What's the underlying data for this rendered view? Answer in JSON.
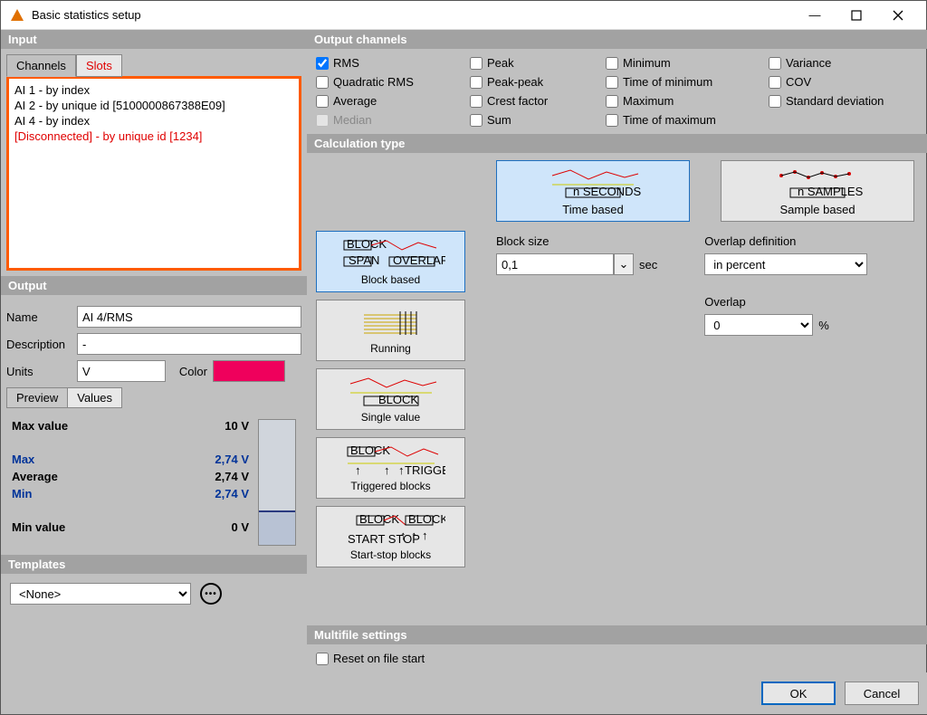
{
  "window": {
    "title": "Basic statistics setup"
  },
  "winbtns": {
    "min": "–",
    "max": "▢",
    "close": "✕"
  },
  "input": {
    "header": "Input",
    "tabs": {
      "channels": "Channels",
      "slots": "Slots"
    },
    "items": [
      {
        "text": "AI 1 - by index",
        "cls": ""
      },
      {
        "text": "AI 2 - by unique id [5100000867388E09]",
        "cls": ""
      },
      {
        "text": "AI 4 - by index",
        "cls": ""
      },
      {
        "text": "[Disconnected] - by unique id [1234]",
        "cls": "disconnected"
      }
    ]
  },
  "output": {
    "header": "Output",
    "nameLabel": "Name",
    "descLabel": "Description",
    "unitsLabel": "Units",
    "colorLabel": "Color",
    "name": "AI 4/RMS",
    "desc": "-",
    "units": "V",
    "color": "#ef005c",
    "previewTab": "Preview",
    "valuesTab": "Values",
    "stats": {
      "maxValueLabel": "Max value",
      "maxValue": "10 V",
      "maxLabel": "Max",
      "max": "2,74 V",
      "avgLabel": "Average",
      "avg": "2,74 V",
      "minLabel": "Min",
      "min": "2,74 V",
      "minValueLabel": "Min value",
      "minValue": "0 V"
    }
  },
  "templates": {
    "header": "Templates",
    "value": "<None>"
  },
  "outputCh": {
    "header": "Output channels",
    "items": [
      {
        "label": "RMS",
        "checked": true
      },
      {
        "label": "Peak",
        "checked": false
      },
      {
        "label": "Minimum",
        "checked": false
      },
      {
        "label": "Variance",
        "checked": false
      },
      {
        "label": "Quadratic RMS",
        "checked": false
      },
      {
        "label": "Peak-peak",
        "checked": false
      },
      {
        "label": "Time of minimum",
        "checked": false
      },
      {
        "label": "COV",
        "checked": false
      },
      {
        "label": "Average",
        "checked": false
      },
      {
        "label": "Crest factor",
        "checked": false
      },
      {
        "label": "Maximum",
        "checked": false
      },
      {
        "label": "Standard deviation",
        "checked": false
      },
      {
        "label": "Median",
        "checked": false,
        "disabled": true
      },
      {
        "label": "Sum",
        "checked": false
      },
      {
        "label": "Time of maximum",
        "checked": false
      }
    ]
  },
  "calc": {
    "header": "Calculation type",
    "timeBased": "Time based",
    "sampleBased": "Sample based",
    "blockBased": "Block based",
    "running": "Running",
    "singleValue": "Single value",
    "triggered": "Triggered blocks",
    "startStop": "Start-stop blocks",
    "blockSizeLabel": "Block size",
    "blockSize": "0,1",
    "blockSizeUnit": "sec",
    "overlapDefLabel": "Overlap definition",
    "overlapDef": "in percent",
    "overlapLabel": "Overlap",
    "overlap": "0",
    "overlapUnit": "%"
  },
  "multifile": {
    "header": "Multifile settings",
    "reset": "Reset on file start"
  },
  "footer": {
    "ok": "OK",
    "cancel": "Cancel"
  }
}
